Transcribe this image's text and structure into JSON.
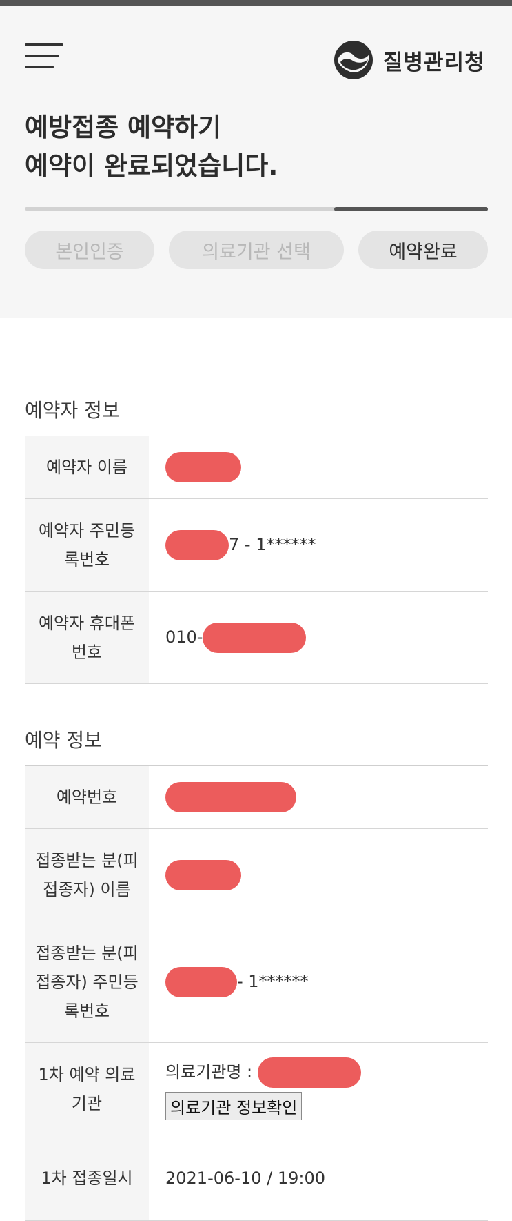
{
  "header": {
    "logo_text": "질병관리청",
    "title_line1": "예방접종 예약하기",
    "title_line2": "예약이 완료되었습니다.",
    "progress_percent": 100,
    "steps": [
      "본인인증",
      "의료기관 선택",
      "예약완료"
    ],
    "active_step": "예약완료"
  },
  "reserver": {
    "section_title": "예약자 정보",
    "name_label": "예약자 이름",
    "rrn_label_line1": "예약자 주민등",
    "rrn_label_line2": "록번호",
    "rrn_suffix": "7 - 1******",
    "phone_label_line1": "예약자 휴대폰",
    "phone_label_line2": "번호",
    "phone_prefix": "010-"
  },
  "reservation": {
    "section_title": "예약 정보",
    "number_label": "예약번호",
    "vaccinee_name_label_line1": "접종받는 분(피",
    "vaccinee_name_label_line2": "접종자) 이름",
    "vaccinee_rrn_label_line1": "접종받는 분(피",
    "vaccinee_rrn_label_line2": "접종자) 주민등",
    "vaccinee_rrn_label_line3": "록번호",
    "vaccinee_rrn_suffix": "- 1******",
    "institution_label_line1": "1차 예약 의료",
    "institution_label_line2": "기관",
    "institution_name_prefix": "의료기관명 :",
    "institution_button": "의료기관 정보확인",
    "date_label": "1차 접종일시",
    "date_value": "2021-06-10 / 19:00"
  },
  "colors": {
    "redaction": "#ec5c5c",
    "header_bg": "#f6f6f6",
    "progress": "#555555"
  }
}
